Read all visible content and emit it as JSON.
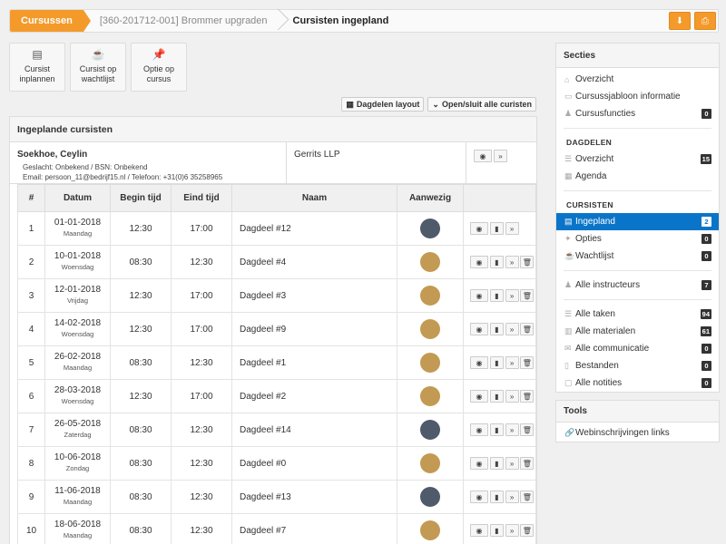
{
  "breadcrumb": {
    "home": "Cursussen",
    "course": "[360-201712-001] Brommer upgraden",
    "current": "Cursisten ingepland"
  },
  "top_actions": [
    "download-icon",
    "print-icon"
  ],
  "tiles": [
    {
      "label1": "Cursist",
      "label2": "inplannen",
      "icon": "id-card-icon"
    },
    {
      "label1": "Cursist op",
      "label2": "wachtlijst",
      "icon": "coffee-icon"
    },
    {
      "label1": "Optie op",
      "label2": "cursus",
      "icon": "pin-icon"
    }
  ],
  "sub_actions": {
    "dagdelen": "Dagdelen layout",
    "toggle": "Open/sluit alle curisten"
  },
  "panel": {
    "title": "Ingeplande cursisten",
    "person": {
      "name": "Soekhoe, Ceylin",
      "meta1": "Geslacht: Onbekend / BSN: Onbekend",
      "meta2": "Email: persoon_11@bedrijf15.nl / Telefoon: +31(0)6 35258965",
      "company": "Gerrits LLP"
    },
    "headers": [
      "#",
      "Datum",
      "Begin tijd",
      "Eind tijd",
      "Naam",
      "Aanwezig",
      ""
    ],
    "rows": [
      {
        "n": "1",
        "date": "01-01-2018",
        "day": "Maandag",
        "begin": "12:30",
        "end": "17:00",
        "name": "Dagdeel #12",
        "present": "dark",
        "delete": false
      },
      {
        "n": "2",
        "date": "10-01-2018",
        "day": "Woensdag",
        "begin": "08:30",
        "end": "12:30",
        "name": "Dagdeel #4",
        "present": "gold",
        "delete": true
      },
      {
        "n": "3",
        "date": "12-01-2018",
        "day": "Vrijdag",
        "begin": "12:30",
        "end": "17:00",
        "name": "Dagdeel #3",
        "present": "gold",
        "delete": true
      },
      {
        "n": "4",
        "date": "14-02-2018",
        "day": "Woensdag",
        "begin": "12:30",
        "end": "17:00",
        "name": "Dagdeel #9",
        "present": "gold",
        "delete": true
      },
      {
        "n": "5",
        "date": "26-02-2018",
        "day": "Maandag",
        "begin": "08:30",
        "end": "12:30",
        "name": "Dagdeel #1",
        "present": "gold",
        "delete": true
      },
      {
        "n": "6",
        "date": "28-03-2018",
        "day": "Woensdag",
        "begin": "12:30",
        "end": "17:00",
        "name": "Dagdeel #2",
        "present": "gold",
        "delete": true
      },
      {
        "n": "7",
        "date": "26-05-2018",
        "day": "Zaterdag",
        "begin": "08:30",
        "end": "12:30",
        "name": "Dagdeel #14",
        "present": "dark",
        "delete": true
      },
      {
        "n": "8",
        "date": "10-06-2018",
        "day": "Zondag",
        "begin": "08:30",
        "end": "12:30",
        "name": "Dagdeel #0",
        "present": "gold",
        "delete": true
      },
      {
        "n": "9",
        "date": "11-06-2018",
        "day": "Maandag",
        "begin": "08:30",
        "end": "12:30",
        "name": "Dagdeel #13",
        "present": "dark",
        "delete": true
      },
      {
        "n": "10",
        "date": "18-06-2018",
        "day": "Maandag",
        "begin": "08:30",
        "end": "12:30",
        "name": "Dagdeel #7",
        "present": "gold",
        "delete": true
      }
    ]
  },
  "sidebar": {
    "title": "Secties",
    "group1": [
      {
        "label": "Overzicht",
        "icon": "home-icon",
        "badge": null
      },
      {
        "label": "Cursussjabloon informatie",
        "icon": "template-icon",
        "badge": null
      },
      {
        "label": "Cursusfuncties",
        "icon": "user-icon",
        "badge": "0"
      }
    ],
    "cap_dagdelen": "DAGDELEN",
    "group2": [
      {
        "label": "Overzicht",
        "icon": "list-icon",
        "badge": "15"
      },
      {
        "label": "Agenda",
        "icon": "calendar-icon",
        "badge": null
      }
    ],
    "cap_cursisten": "CURSISTEN",
    "group3": [
      {
        "label": "Ingepland",
        "icon": "id-card-icon",
        "badge": "2",
        "active": true
      },
      {
        "label": "Opties",
        "icon": "pin-icon",
        "badge": "0"
      },
      {
        "label": "Wachtlijst",
        "icon": "coffee-icon",
        "badge": "0"
      }
    ],
    "group4": [
      {
        "label": "Alle instructeurs",
        "icon": "user-icon",
        "badge": "7"
      }
    ],
    "group5": [
      {
        "label": "Alle taken",
        "icon": "list-icon",
        "badge": "94"
      },
      {
        "label": "Alle materialen",
        "icon": "box-icon",
        "badge": "61"
      },
      {
        "label": "Alle communicatie",
        "icon": "mail-icon",
        "badge": "0"
      },
      {
        "label": "Bestanden",
        "icon": "file-icon",
        "badge": "0"
      },
      {
        "label": "Alle notities",
        "icon": "note-icon",
        "badge": "0"
      }
    ]
  },
  "tools": {
    "title": "Tools",
    "item": "Webinschrijvingen links"
  },
  "colors": {
    "accent": "#f39a2b",
    "active": "#0a75c8",
    "present_dark": "#4f5a6b",
    "present_gold": "#c39a53"
  }
}
